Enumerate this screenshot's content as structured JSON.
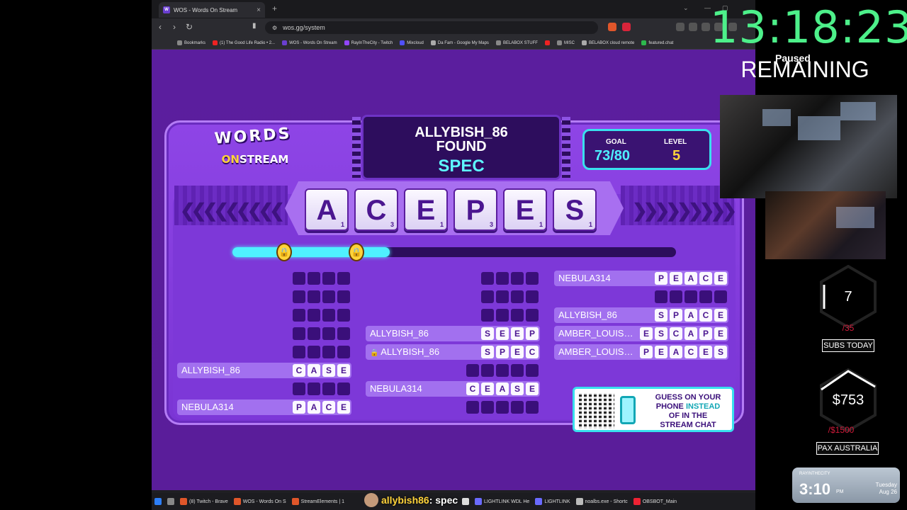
{
  "browser": {
    "tab_title": "WOS - Words On Stream",
    "url": "wos.gg/system",
    "bookmarks": [
      "Bookmarks",
      "(1) The Good Life Radio • 2...",
      "WOS - Words On Stream",
      "RayInTheCity - Twitch",
      "Mixcloud",
      "Da Fam - Google My Maps",
      "BELABOX STUFF",
      "MISC",
      "BELABOX cloud remote",
      "featured.chat"
    ]
  },
  "game": {
    "logo_words": "WORDS",
    "logo_on": "ON",
    "logo_stream": "STREAM",
    "found_user": "ALLYBISH_86",
    "found_label": "FOUND",
    "found_word": "SPEC",
    "goal_label": "GOAL",
    "goal_value": "73/80",
    "level_label": "LEVEL",
    "level_value": "5",
    "progress_fraction": 0.355,
    "tiles": [
      {
        "letter": "A",
        "score": "1"
      },
      {
        "letter": "C",
        "score": "3"
      },
      {
        "letter": "E",
        "score": "1"
      },
      {
        "letter": "P",
        "score": "3"
      },
      {
        "letter": "E",
        "score": "1"
      },
      {
        "letter": "S",
        "score": "1"
      }
    ],
    "columns": [
      [
        {
          "user": "",
          "letters": [],
          "slots": 4
        },
        {
          "user": "",
          "letters": [],
          "slots": 4
        },
        {
          "user": "",
          "letters": [],
          "slots": 4
        },
        {
          "user": "",
          "letters": [],
          "slots": 4
        },
        {
          "user": "",
          "letters": [],
          "slots": 4
        },
        {
          "user": "ALLYBISH_86",
          "letters": [
            "C",
            "A",
            "S",
            "E"
          ],
          "slots": 4
        },
        {
          "user": "",
          "letters": [],
          "slots": 4
        },
        {
          "user": "NEBULA314",
          "letters": [
            "P",
            "A",
            "C",
            "E"
          ],
          "slots": 4
        }
      ],
      [
        {
          "user": "",
          "letters": [],
          "slots": 4
        },
        {
          "user": "",
          "letters": [],
          "slots": 4
        },
        {
          "user": "",
          "letters": [],
          "slots": 4
        },
        {
          "user": "ALLYBISH_86",
          "letters": [
            "S",
            "E",
            "E",
            "P"
          ],
          "slots": 4
        },
        {
          "user": "ALLYBISH_86",
          "letters": [
            "S",
            "P",
            "E",
            "C"
          ],
          "slots": 4,
          "locked": true
        },
        {
          "user": "",
          "letters": [],
          "slots": 5
        },
        {
          "user": "NEBULA314",
          "letters": [
            "C",
            "E",
            "A",
            "S",
            "E"
          ],
          "slots": 5
        },
        {
          "user": "",
          "letters": [],
          "slots": 5
        }
      ],
      [
        {
          "user": "NEBULA314",
          "letters": [
            "P",
            "E",
            "A",
            "C",
            "E"
          ],
          "slots": 5
        },
        {
          "user": "",
          "letters": [],
          "slots": 5
        },
        {
          "user": "ALLYBISH_86",
          "letters": [
            "S",
            "P",
            "A",
            "C",
            "E"
          ],
          "slots": 5
        },
        {
          "user": "AMBER_LOUIS…",
          "letters": [
            "E",
            "S",
            "C",
            "A",
            "P",
            "E"
          ],
          "slots": 6
        },
        {
          "user": "AMBER_LOUIS…",
          "letters": [
            "P",
            "E",
            "A",
            "C",
            "E",
            "S"
          ],
          "slots": 6
        }
      ]
    ],
    "banner_line1": "GUESS ON YOUR",
    "banner_phone": "PHONE",
    "banner_instead": " INSTEAD",
    "banner_line3": "OF IN THE",
    "banner_line4": "STREAM CHAT"
  },
  "overlay": {
    "timer": "13:18:23",
    "paused": "Paused",
    "remaining": "REMAINING",
    "subs_value": "7",
    "subs_goal": "/35",
    "subs_label": "SUBS TODAY",
    "money_value": "$753",
    "money_goal": "/$1500",
    "money_label": "PAX AUSTRALIA",
    "clock_handle": "RAYINTHECITY",
    "clock_time": "3:10",
    "clock_ampm": "PM",
    "clock_day": "Tuesday",
    "clock_date": "Aug 26"
  },
  "taskbar": {
    "items": [
      "(8) Twitch - Brave",
      "WOS - Words On S",
      "StreamElements | 1",
      "LIGHTLINK WDL He",
      "LIGHTLINK",
      "noalbs.exe - Shortc",
      "OBSBOT_Main"
    ],
    "chat_user": "allybish86",
    "chat_msg": ": spec"
  },
  "colors": {
    "accent_cyan": "#4ff0ff",
    "board_purple": "#7d38d8",
    "timer_green": "#4df08a",
    "goal_red": "#d11a3a"
  }
}
